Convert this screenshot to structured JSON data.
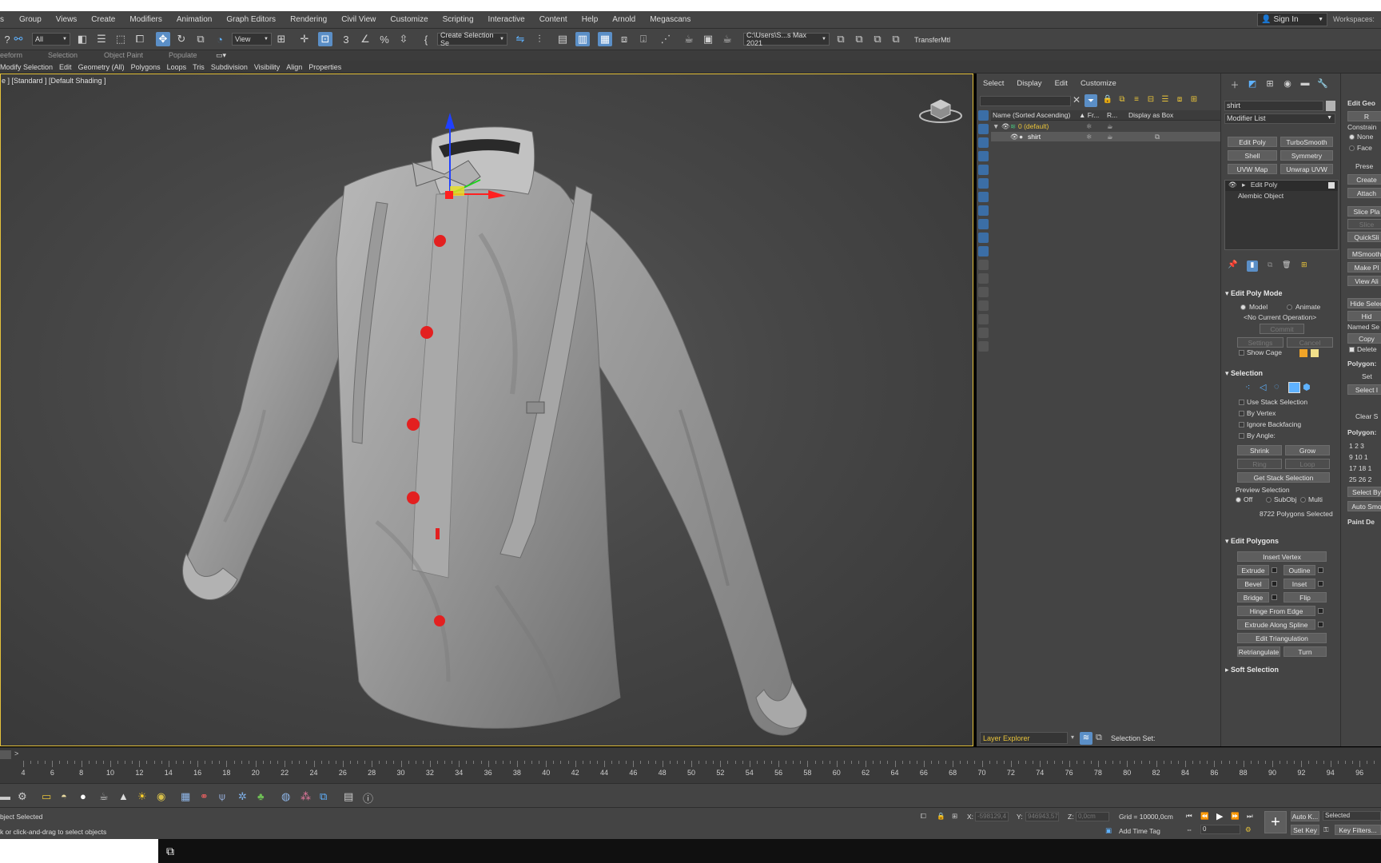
{
  "menu": [
    "Group",
    "Views",
    "Create",
    "Modifiers",
    "Animation",
    "Graph Editors",
    "Rendering",
    "Civil View",
    "Customize",
    "Scripting",
    "Interactive",
    "Content",
    "Help",
    "Arnold",
    "Megascans"
  ],
  "signin": "Sign In",
  "workspaces": "Workspaces:",
  "toolbar": {
    "selection_filter": "All",
    "ref_coord": "View",
    "create_selection_set": "Create Selection Se",
    "project_path": "C:\\Users\\S...s Max 2021",
    "transfer": "TransferMtl"
  },
  "ribbon_tabs": [
    "eeform",
    "Selection",
    "Object Paint",
    "Populate"
  ],
  "ribbon_items": [
    "Modify Selection",
    "Edit",
    "Geometry (All)",
    "Polygons",
    "Loops",
    "Tris",
    "Subdivision",
    "Visibility",
    "Align",
    "Properties"
  ],
  "viewport": {
    "label": "e ] [Standard ] [Default Shading ]"
  },
  "explorer": {
    "menu": [
      "Select",
      "Display",
      "Edit",
      "Customize"
    ],
    "columns": {
      "name": "Name (Sorted Ascending)",
      "fr": "▲ Fr...",
      "r": "R...",
      "box": "Display as Box"
    },
    "rows": [
      {
        "name": "0 (default)"
      },
      {
        "name": "shirt"
      }
    ],
    "layer_explorer": "Layer Explorer",
    "selection_set": "Selection Set:"
  },
  "command_panel": {
    "object_name": "shirt",
    "modifier_list": "Modifier List",
    "buttons": [
      "Edit Poly",
      "TurboSmooth",
      "Shell",
      "Symmetry",
      "UVW Map",
      "Unwrap UVW"
    ],
    "stack": [
      "Edit Poly",
      "Alembic Object"
    ],
    "edit_poly_mode": {
      "title": "Edit Poly Mode",
      "model": "Model",
      "animate": "Animate",
      "operation": "<No Current Operation>",
      "commit": "Commit",
      "settings": "Settings",
      "cancel": "Cancel",
      "show_cage": "Show Cage"
    },
    "selection": {
      "title": "Selection",
      "use_stack": "Use Stack Selection",
      "by_vertex": "By Vertex",
      "ignore_backfacing": "Ignore Backfacing",
      "by_angle": "By Angle:",
      "shrink": "Shrink",
      "grow": "Grow",
      "ring": "Ring",
      "loop": "Loop",
      "get_stack": "Get Stack Selection",
      "preview": "Preview Selection",
      "off": "Off",
      "subobj": "SubObj",
      "multi": "Multi",
      "count": "8722 Polygons Selected"
    },
    "edit_polygons": {
      "title": "Edit Polygons",
      "insert_vertex": "Insert Vertex",
      "extrude": "Extrude",
      "outline": "Outline",
      "bevel": "Bevel",
      "inset": "Inset",
      "bridge": "Bridge",
      "flip": "Flip",
      "hinge": "Hinge From Edge",
      "extrude_spline": "Extrude Along Spline",
      "edit_tri": "Edit Triangulation",
      "retriangulate": "Retriangulate",
      "turn": "Turn"
    },
    "soft_selection": "Soft Selection"
  },
  "col2": [
    "Edit Geo",
    "R",
    "Constrain",
    "None",
    "Face",
    "Prese",
    "Create",
    "Attach",
    "Slice Pla",
    "Slice",
    "QuickSli",
    "MSmooth",
    "Make Pl",
    "View Ali",
    "Hide Selec",
    "Hid",
    "Named Se",
    "Copy",
    "Delete",
    "Polygon:",
    "Set",
    "Select I",
    "Clear S",
    "Polygon:",
    "1 2 3",
    "9 10 1",
    "17 18 1",
    "25 26 2",
    "Select By",
    "Auto Smo",
    "Paint De"
  ],
  "timeline": {
    "next": ">",
    "ticks": [
      "4",
      "6",
      "8",
      "10",
      "12",
      "14",
      "16",
      "18",
      "20",
      "22",
      "24",
      "26",
      "28",
      "30",
      "32",
      "34",
      "36",
      "38",
      "40",
      "42",
      "44",
      "46",
      "48",
      "50",
      "52",
      "54",
      "56",
      "58",
      "60",
      "62",
      "64",
      "66",
      "68",
      "70",
      "72",
      "74",
      "76",
      "78",
      "80",
      "82",
      "84",
      "86",
      "88",
      "90",
      "92",
      "94",
      "96"
    ]
  },
  "status": {
    "line1": "bject Selected",
    "line2": "k or click-and-drag to select objects",
    "x_label": "X:",
    "x_val": "-598129,4",
    "y_label": "Y:",
    "y_val": "946943,57",
    "z_label": "Z:",
    "z_val": "0,0cm",
    "grid": "Grid = 10000,0cm",
    "add_time_tag": "Add Time Tag",
    "auto_key": "Auto K...",
    "selected": "Selected",
    "set_key": "Set Key",
    "key_filters": "Key Filters...",
    "frame": "0"
  },
  "colors": {
    "accent_blue": "#5b8fc7",
    "viewport_border": "#e5c23b",
    "button_red": "#e32020"
  }
}
